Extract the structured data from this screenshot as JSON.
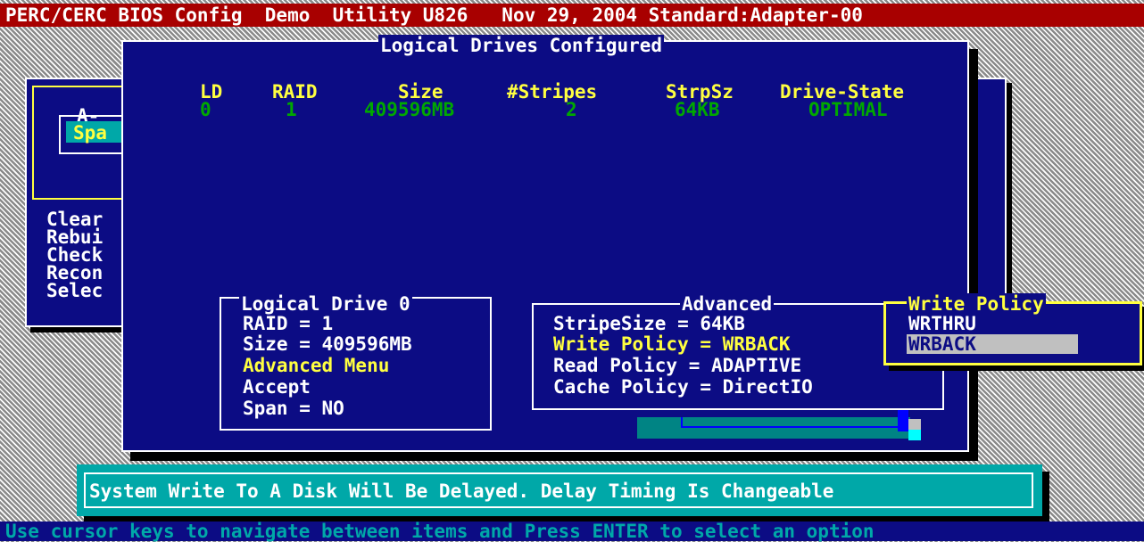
{
  "title_bar": {
    "app": "PERC/CERC BIOS Config  Demo  Utility U826   Nov 29, 2004 Standard:Adapter-00"
  },
  "background_menu": {
    "box_label": "A-",
    "span_item": "Spa",
    "items": [
      "Clear",
      "Rebui",
      "Check",
      "Recon",
      "Selec"
    ]
  },
  "logical_drives": {
    "window_title": "Logical Drives Configured",
    "columns": [
      "LD",
      "RAID",
      "Size",
      "#Stripes",
      "StrpSz",
      "Drive-State"
    ],
    "rows": [
      {
        "ld": "0",
        "raid": "1",
        "size": "409596MB",
        "stripes": "2",
        "strpsz": "64KB",
        "state": "OPTIMAL"
      }
    ]
  },
  "logical_drive_panel": {
    "title": "Logical Drive 0",
    "raid": "RAID = 1",
    "size": "Size = 409596MB",
    "advanced_menu": "Advanced Menu",
    "accept": "Accept",
    "span": "Span = NO"
  },
  "advanced_panel": {
    "title": "Advanced",
    "stripe_size": "StripeSize = 64KB",
    "write_policy": "Write Policy = WRBACK",
    "read_policy": "Read Policy = ADAPTIVE",
    "cache_policy": "Cache Policy = DirectIO"
  },
  "write_policy_popup": {
    "title": "Write Policy",
    "options": [
      "WRTHRU",
      "WRBACK"
    ],
    "selected": "WRBACK"
  },
  "help_text": "System Write To A Disk Will Be Delayed. Delay Timing Is Changeable",
  "status_bar": "Use cursor keys to navigate between items and Press ENTER to select an option",
  "colors": {
    "background_blue": "#0c0c84",
    "title_red": "#a80000",
    "highlight_yellow": "#ffff40",
    "data_green": "#00a800",
    "help_cyan": "#00a8a8"
  }
}
